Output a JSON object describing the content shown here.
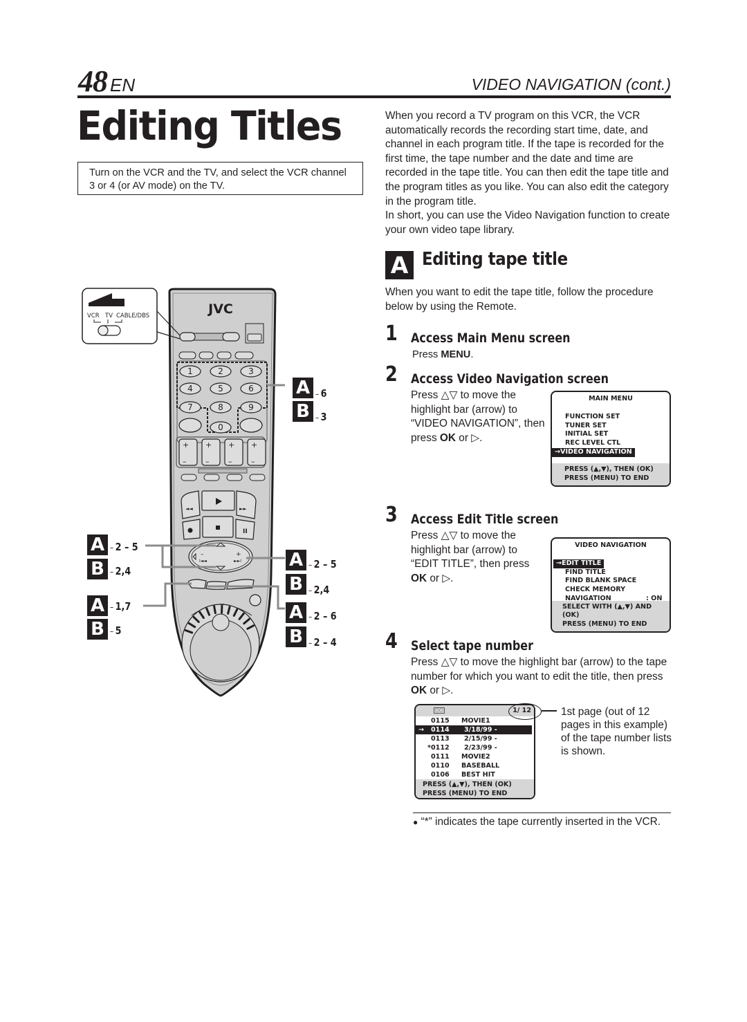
{
  "header": {
    "page_number": "48",
    "language": "EN",
    "section": "VIDEO NAVIGATION (cont.)"
  },
  "page_title": "Editing Titles",
  "intro_box": "Turn on the VCR and the TV, and select the VCR channel 3 or 4 (or AV mode) on the TV.",
  "intro_paragraph": [
    "When you record a TV program on this VCR, the VCR automatically records the recording start time, date, and channel in each program title. If the tape is recorded for the first time, the tape number and the date and time are recorded in the tape title. You can then edit the tape title and the program titles as you like. You can also edit the category in the program title.",
    "In short, you can use the Video Navigation function to create your own video tape library."
  ],
  "section_a": {
    "badge": "A",
    "heading": "Editing tape title",
    "intro": "When you want to edit the tape title, follow the procedure below by using the Remote."
  },
  "steps": [
    {
      "number": "1",
      "title": "Access Main Menu screen",
      "text_prefix": "Press ",
      "text_bold": "MENU",
      "text_suffix": "."
    },
    {
      "number": "2",
      "title": "Access Video Navigation screen",
      "text_prefix": "Press △▽ to move the highlight bar (arrow) to “VIDEO NAVIGATION”, then press ",
      "text_bold": "OK",
      "text_suffix": " or ▷."
    },
    {
      "number": "3",
      "title": "Access Edit Title screen",
      "text_prefix": "Press △▽ to move the highlight bar (arrow) to “EDIT TITLE”, then press ",
      "text_bold": "OK",
      "text_suffix": " or ▷."
    },
    {
      "number": "4",
      "title": "Select tape number",
      "text_prefix": "Press △▽ to move the highlight bar (arrow) to the tape number for which you want to edit the title, then press ",
      "text_bold": "OK",
      "text_suffix": " or ▷."
    }
  ],
  "main_menu_screen": {
    "title": "MAIN MENU",
    "items": [
      "FUNCTION SET",
      "TUNER SET",
      "INITIAL SET",
      "REC LEVEL CTL"
    ],
    "highlighted": "→VIDEO NAVIGATION",
    "footer": [
      "PRESS (▲,▼), THEN (OK)",
      "PRESS (MENU) TO END"
    ]
  },
  "video_nav_screen": {
    "title": "VIDEO NAVIGATION",
    "highlighted": "→EDIT TITLE",
    "items": [
      "FIND TITLE",
      "FIND BLANK SPACE",
      "CHECK MEMORY"
    ],
    "navigation_label": "NAVIGATION",
    "navigation_value": ": ON",
    "footer": [
      "SELECT WITH (▲,▼) AND (OK)",
      "PRESS (MENU) TO END"
    ]
  },
  "tape_list_screen": {
    "cassette_icon": "cassette-icon",
    "page_indicator": "1/ 12",
    "rows": [
      {
        "mark": "",
        "number": "0115",
        "title": "MOVIE1",
        "highlighted": false
      },
      {
        "mark": "→",
        "number": "0114",
        "title": "3/18/99 -",
        "highlighted": true
      },
      {
        "mark": "",
        "number": "0113",
        "title": "2/15/99 -",
        "highlighted": false
      },
      {
        "mark": "*",
        "number": "0112",
        "title": "2/23/99 -",
        "highlighted": false
      },
      {
        "mark": "",
        "number": "0111",
        "title": "MOVIE2",
        "highlighted": false
      },
      {
        "mark": "",
        "number": "0110",
        "title": "BASEBALL",
        "highlighted": false
      },
      {
        "mark": "",
        "number": "0106",
        "title": "BEST HIT",
        "highlighted": false
      }
    ],
    "footer": [
      "PRESS (▲,▼), THEN (OK)",
      "PRESS (MENU) TO END"
    ]
  },
  "tape_list_callout": "1st page (out of 12 pages in this example) of the tape number lists is shown.",
  "note": {
    "bullet": "●",
    "text": "“*” indicates the tape currently inserted in the VCR."
  },
  "remote": {
    "brand": "JVC",
    "switch_labels": {
      "vcr": "VCR",
      "tv": "TV",
      "cable": "CABLE/DBS"
    },
    "number_keys": [
      "1",
      "2",
      "3",
      "4",
      "5",
      "6",
      "7",
      "8",
      "9",
      "0"
    ],
    "callouts": [
      {
        "badge": "A",
        "ref": "6"
      },
      {
        "badge": "B",
        "ref": "3"
      },
      {
        "badge": "A",
        "ref": "2 – 5"
      },
      {
        "badge": "B",
        "ref": "2,4"
      },
      {
        "badge": "A",
        "ref": "1,7"
      },
      {
        "badge": "B",
        "ref": "5"
      },
      {
        "badge": "A",
        "ref": "2 – 5"
      },
      {
        "badge": "B",
        "ref": "2,4"
      },
      {
        "badge": "A",
        "ref": "2 – 6"
      },
      {
        "badge": "B",
        "ref": "2 – 4"
      }
    ]
  }
}
